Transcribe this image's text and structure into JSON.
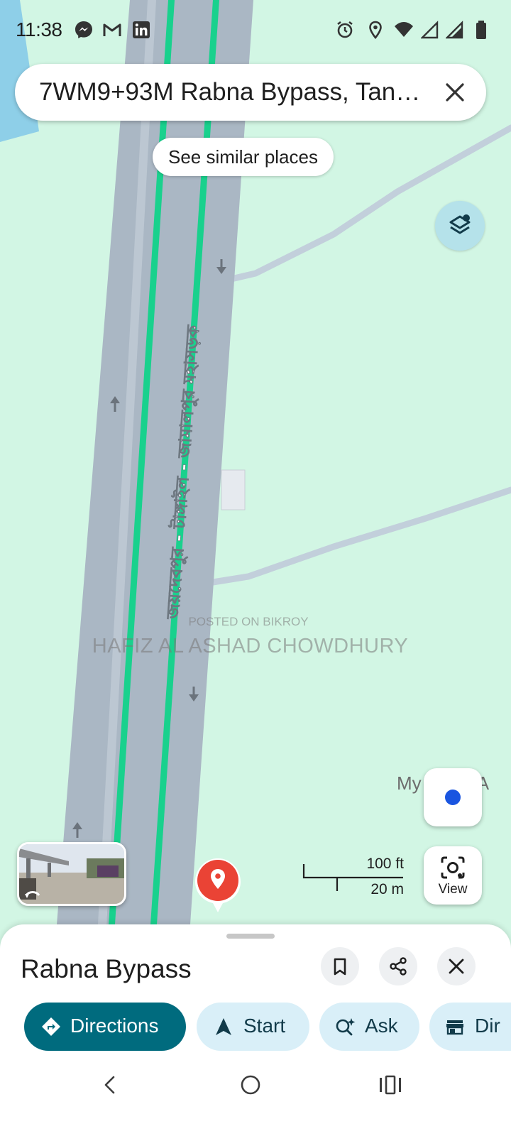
{
  "status_bar": {
    "time": "11:38",
    "left_icons": [
      "messenger-icon",
      "gmail-icon",
      "linkedin-icon"
    ],
    "right_icons": [
      "alarm-icon",
      "location-icon",
      "wifi-icon",
      "signal-icon",
      "signal-icon",
      "battery-icon"
    ]
  },
  "search": {
    "query": "7WM9+93M Rabna Bypass, Tan…"
  },
  "chips": {
    "similar_places": "See similar places"
  },
  "map": {
    "road_label": "জয়দেবপুর - টাঙ্গাইল - জামালপুর মহাসড়ক",
    "partial_place_label": "My        e A",
    "watermark_top": "POSTED ON BIKROY",
    "watermark_name": "HAFIZ AL ASHAD CHOWDHURY",
    "scale": {
      "imperial": "100 ft",
      "metric": "20 m"
    },
    "colors": {
      "land": "#d2f6e4",
      "road": "#aab7c4",
      "road_highlight": "#19d18d",
      "water": "#8ecfe8"
    }
  },
  "controls": {
    "view_label": "View"
  },
  "sheet": {
    "title": "Rabna Bypass",
    "actions": [
      {
        "label": "Directions",
        "icon": "directions-icon",
        "primary": true
      },
      {
        "label": "Start",
        "icon": "navigation-arrow-icon",
        "primary": false
      },
      {
        "label": "Ask",
        "icon": "ask-sparkle-icon",
        "primary": false
      },
      {
        "label": "Dir",
        "icon": "storefront-icon",
        "primary": false
      }
    ]
  },
  "nav": {
    "icons": [
      "back-icon",
      "home-icon",
      "recents-icon"
    ]
  }
}
